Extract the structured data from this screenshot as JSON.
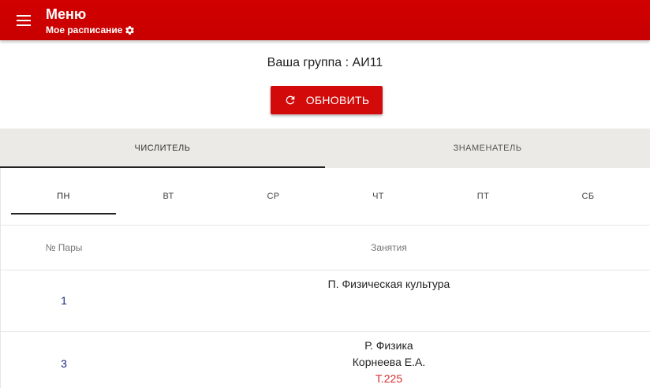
{
  "appbar": {
    "title": "Меню",
    "subtitle": "Мое расписание",
    "menu_icon": "hamburger-icon",
    "settings_icon": "gear-icon",
    "color": "#c80000"
  },
  "group": {
    "label": "Ваша группа : АИ11"
  },
  "refresh_button": {
    "label": "ОБНОВИТЬ",
    "icon": "refresh-icon"
  },
  "week_tabs": [
    {
      "label": "ЧИСЛИТЕЛЬ",
      "active": true
    },
    {
      "label": "ЗНАМЕНАТЕЛЬ",
      "active": false
    }
  ],
  "day_tabs": [
    {
      "label": "ПН",
      "active": true
    },
    {
      "label": "ВТ",
      "active": false
    },
    {
      "label": "СР",
      "active": false
    },
    {
      "label": "ЧТ",
      "active": false
    },
    {
      "label": "ПТ",
      "active": false
    },
    {
      "label": "СБ",
      "active": false
    }
  ],
  "table": {
    "headers": {
      "number": "№ Пары",
      "lessons": "Занятия"
    },
    "rows": [
      {
        "number": "1",
        "subject": "П. Физическая культура",
        "teacher": "",
        "room": ""
      },
      {
        "number": "3",
        "subject": "Р. Физика",
        "teacher": "Корнеева Е.А.",
        "room": "Т.225"
      }
    ]
  }
}
